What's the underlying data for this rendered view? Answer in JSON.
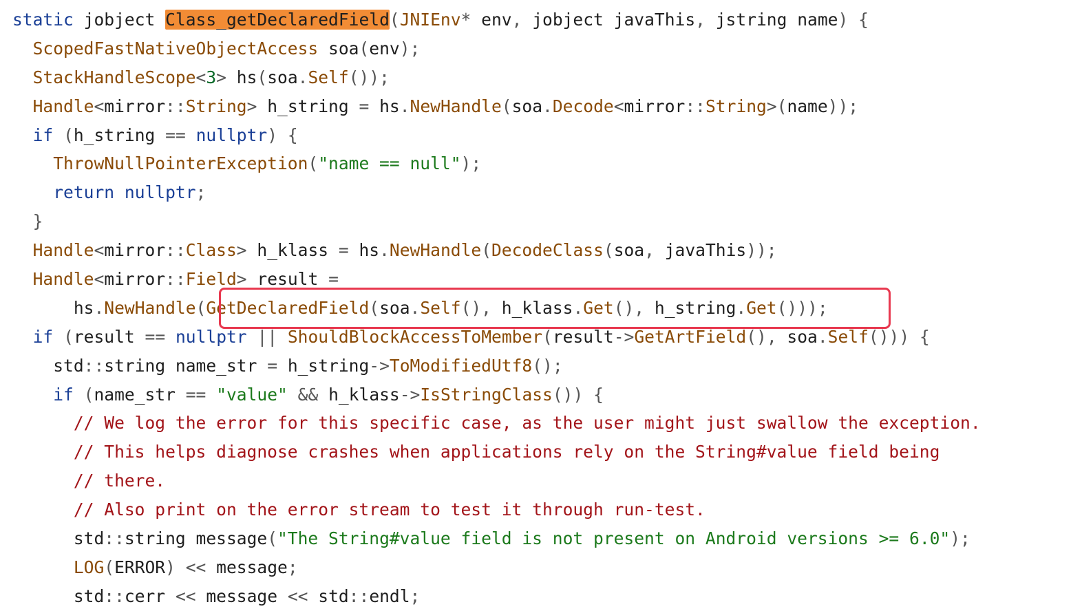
{
  "colors": {
    "keyword": "#1a3f96",
    "function": "#8a4b07",
    "string": "#1c7a1c",
    "comment": "#a3151a",
    "number": "#0b6b2a",
    "highlight": "#f28c35",
    "callout": "#e8384f"
  },
  "code": {
    "lines": [
      [
        [
          "kw",
          "static"
        ],
        [
          "t",
          " "
        ],
        [
          "type",
          "jobject"
        ],
        [
          "t",
          " "
        ],
        [
          "hl",
          "Class_getDeclaredField"
        ],
        [
          "p",
          "("
        ],
        [
          "fn",
          "JNIEnv"
        ],
        [
          "op",
          "*"
        ],
        [
          "t",
          " env"
        ],
        [
          "p",
          ","
        ],
        [
          "t",
          " "
        ],
        [
          "type",
          "jobject"
        ],
        [
          "t",
          " javaThis"
        ],
        [
          "p",
          ","
        ],
        [
          "t",
          " "
        ],
        [
          "type",
          "jstring"
        ],
        [
          "t",
          " name"
        ],
        [
          "p",
          ")"
        ],
        [
          "t",
          " "
        ],
        [
          "p",
          "{"
        ]
      ],
      [
        [
          "t",
          "  "
        ],
        [
          "fn",
          "ScopedFastNativeObjectAccess"
        ],
        [
          "t",
          " soa"
        ],
        [
          "p",
          "("
        ],
        [
          "t",
          "env"
        ],
        [
          "p",
          ");"
        ]
      ],
      [
        [
          "t",
          "  "
        ],
        [
          "fn",
          "StackHandleScope"
        ],
        [
          "op",
          "<"
        ],
        [
          "num",
          "3"
        ],
        [
          "op",
          ">"
        ],
        [
          "t",
          " hs"
        ],
        [
          "p",
          "("
        ],
        [
          "t",
          "soa"
        ],
        [
          "op",
          "."
        ],
        [
          "fn",
          "Self"
        ],
        [
          "p",
          "());"
        ]
      ],
      [
        [
          "t",
          "  "
        ],
        [
          "fn",
          "Handle"
        ],
        [
          "op",
          "<"
        ],
        [
          "t",
          "mirror"
        ],
        [
          "op",
          "::"
        ],
        [
          "fn",
          "String"
        ],
        [
          "op",
          ">"
        ],
        [
          "t",
          " h_string "
        ],
        [
          "op",
          "="
        ],
        [
          "t",
          " hs"
        ],
        [
          "op",
          "."
        ],
        [
          "fn",
          "NewHandle"
        ],
        [
          "p",
          "("
        ],
        [
          "t",
          "soa"
        ],
        [
          "op",
          "."
        ],
        [
          "fn",
          "Decode"
        ],
        [
          "op",
          "<"
        ],
        [
          "t",
          "mirror"
        ],
        [
          "op",
          "::"
        ],
        [
          "fn",
          "String"
        ],
        [
          "op",
          ">"
        ],
        [
          "p",
          "("
        ],
        [
          "t",
          "name"
        ],
        [
          "p",
          "));"
        ]
      ],
      [
        [
          "t",
          "  "
        ],
        [
          "kw",
          "if"
        ],
        [
          "t",
          " "
        ],
        [
          "p",
          "("
        ],
        [
          "t",
          "h_string "
        ],
        [
          "op",
          "=="
        ],
        [
          "t",
          " "
        ],
        [
          "kw",
          "nullptr"
        ],
        [
          "p",
          ")"
        ],
        [
          "t",
          " "
        ],
        [
          "p",
          "{"
        ]
      ],
      [
        [
          "t",
          "    "
        ],
        [
          "fn",
          "ThrowNullPointerException"
        ],
        [
          "p",
          "("
        ],
        [
          "str",
          "\"name == null\""
        ],
        [
          "p",
          ");"
        ]
      ],
      [
        [
          "t",
          "    "
        ],
        [
          "kw",
          "return"
        ],
        [
          "t",
          " "
        ],
        [
          "kw",
          "nullptr"
        ],
        [
          "p",
          ";"
        ]
      ],
      [
        [
          "t",
          "  "
        ],
        [
          "p",
          "}"
        ]
      ],
      [
        [
          "t",
          "  "
        ],
        [
          "fn",
          "Handle"
        ],
        [
          "op",
          "<"
        ],
        [
          "t",
          "mirror"
        ],
        [
          "op",
          "::"
        ],
        [
          "fn",
          "Class"
        ],
        [
          "op",
          ">"
        ],
        [
          "t",
          " h_klass "
        ],
        [
          "op",
          "="
        ],
        [
          "t",
          " hs"
        ],
        [
          "op",
          "."
        ],
        [
          "fn",
          "NewHandle"
        ],
        [
          "p",
          "("
        ],
        [
          "fn",
          "DecodeClass"
        ],
        [
          "p",
          "("
        ],
        [
          "t",
          "soa"
        ],
        [
          "p",
          ","
        ],
        [
          "t",
          " javaThis"
        ],
        [
          "p",
          "));"
        ]
      ],
      [
        [
          "t",
          "  "
        ],
        [
          "fn",
          "Handle"
        ],
        [
          "op",
          "<"
        ],
        [
          "t",
          "mirror"
        ],
        [
          "op",
          "::"
        ],
        [
          "fn",
          "Field"
        ],
        [
          "op",
          ">"
        ],
        [
          "t",
          " result "
        ],
        [
          "op",
          "="
        ]
      ],
      [
        [
          "t",
          "      hs"
        ],
        [
          "op",
          "."
        ],
        [
          "fn",
          "NewHandle"
        ],
        [
          "p",
          "("
        ],
        [
          "fn",
          "GetDeclaredField"
        ],
        [
          "p",
          "("
        ],
        [
          "t",
          "soa"
        ],
        [
          "op",
          "."
        ],
        [
          "fn",
          "Self"
        ],
        [
          "p",
          "(),"
        ],
        [
          "t",
          " h_klass"
        ],
        [
          "op",
          "."
        ],
        [
          "fn",
          "Get"
        ],
        [
          "p",
          "(),"
        ],
        [
          "t",
          " h_string"
        ],
        [
          "op",
          "."
        ],
        [
          "fn",
          "Get"
        ],
        [
          "p",
          "()));"
        ]
      ],
      [
        [
          "t",
          "  "
        ],
        [
          "kw",
          "if"
        ],
        [
          "t",
          " "
        ],
        [
          "p",
          "("
        ],
        [
          "t",
          "result "
        ],
        [
          "op",
          "=="
        ],
        [
          "t",
          " "
        ],
        [
          "kw",
          "nullptr"
        ],
        [
          "t",
          " "
        ],
        [
          "op",
          "||"
        ],
        [
          "t",
          " "
        ],
        [
          "fn",
          "ShouldBlockAccessToMember"
        ],
        [
          "p",
          "("
        ],
        [
          "t",
          "result"
        ],
        [
          "op",
          "->"
        ],
        [
          "fn",
          "GetArtField"
        ],
        [
          "p",
          "(),"
        ],
        [
          "t",
          " soa"
        ],
        [
          "op",
          "."
        ],
        [
          "fn",
          "Self"
        ],
        [
          "p",
          "()))"
        ],
        [
          "t",
          " "
        ],
        [
          "p",
          "{"
        ]
      ],
      [
        [
          "t",
          "    std"
        ],
        [
          "op",
          "::"
        ],
        [
          "t",
          "string name_str "
        ],
        [
          "op",
          "="
        ],
        [
          "t",
          " h_string"
        ],
        [
          "op",
          "->"
        ],
        [
          "fn",
          "ToModifiedUtf8"
        ],
        [
          "p",
          "();"
        ]
      ],
      [
        [
          "t",
          "    "
        ],
        [
          "kw",
          "if"
        ],
        [
          "t",
          " "
        ],
        [
          "p",
          "("
        ],
        [
          "t",
          "name_str "
        ],
        [
          "op",
          "=="
        ],
        [
          "t",
          " "
        ],
        [
          "str",
          "\"value\""
        ],
        [
          "t",
          " "
        ],
        [
          "op",
          "&&"
        ],
        [
          "t",
          " h_klass"
        ],
        [
          "op",
          "->"
        ],
        [
          "fn",
          "IsStringClass"
        ],
        [
          "p",
          "())"
        ],
        [
          "t",
          " "
        ],
        [
          "p",
          "{"
        ]
      ],
      [
        [
          "t",
          "      "
        ],
        [
          "cmt",
          "// We log the error for this specific case, as the user might just swallow the exception."
        ]
      ],
      [
        [
          "t",
          "      "
        ],
        [
          "cmt",
          "// This helps diagnose crashes when applications rely on the String#value field being"
        ]
      ],
      [
        [
          "t",
          "      "
        ],
        [
          "cmt",
          "// there."
        ]
      ],
      [
        [
          "t",
          "      "
        ],
        [
          "cmt",
          "// Also print on the error stream to test it through run-test."
        ]
      ],
      [
        [
          "t",
          "      std"
        ],
        [
          "op",
          "::"
        ],
        [
          "t",
          "string message"
        ],
        [
          "p",
          "("
        ],
        [
          "str",
          "\"The String#value field is not present on Android versions >= 6.0\""
        ],
        [
          "p",
          ");"
        ]
      ],
      [
        [
          "t",
          "      "
        ],
        [
          "fn",
          "LOG"
        ],
        [
          "p",
          "("
        ],
        [
          "t",
          "ERROR"
        ],
        [
          "p",
          ")"
        ],
        [
          "t",
          " "
        ],
        [
          "op",
          "<<"
        ],
        [
          "t",
          " message"
        ],
        [
          "p",
          ";"
        ]
      ],
      [
        [
          "t",
          "      std"
        ],
        [
          "op",
          "::"
        ],
        [
          "t",
          "cerr "
        ],
        [
          "op",
          "<<"
        ],
        [
          "t",
          " message "
        ],
        [
          "op",
          "<<"
        ],
        [
          "t",
          " std"
        ],
        [
          "op",
          "::"
        ],
        [
          "t",
          "endl"
        ],
        [
          "p",
          ";"
        ]
      ]
    ]
  }
}
